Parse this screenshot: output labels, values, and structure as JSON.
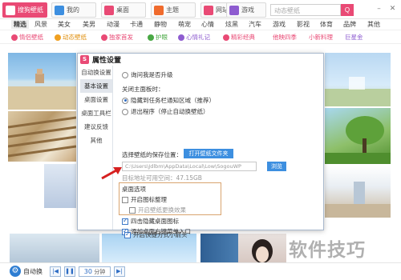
{
  "top_tabs": [
    {
      "label": "搜狗壁纸",
      "color": "#e94a75",
      "active": true
    },
    {
      "label": "我的",
      "color": "#3d8fe0",
      "active": false
    },
    {
      "label": "桌面",
      "color": "#e94a75",
      "active": false
    },
    {
      "label": "主题",
      "color": "#f06b2d",
      "active": false
    },
    {
      "label": "网站",
      "color": "#e94a75",
      "active": false
    },
    {
      "label": "游戏",
      "color": "#8e5cd0",
      "active": false
    }
  ],
  "search": {
    "placeholder": "动态壁纸",
    "button": "Q"
  },
  "window_buttons": {
    "minimize": "–",
    "close": "✕"
  },
  "categories": [
    "精选",
    "风景",
    "美女",
    "美男",
    "动漫",
    "卡通",
    "静物",
    "萌宠",
    "心情",
    "炫黑",
    "汽车",
    "游戏",
    "影视",
    "体育",
    "品牌",
    "其他"
  ],
  "sub_tags": [
    {
      "label": "情侣壁纸",
      "color": "#e94a75"
    },
    {
      "label": "动态壁纸",
      "color": "#f0a020"
    },
    {
      "label": "独家首发",
      "color": "#e94a75"
    },
    {
      "label": "护眼",
      "color": "#49a844"
    },
    {
      "label": "心情礼记",
      "color": "#8e5cd0"
    },
    {
      "label": "精彩经典",
      "color": "#e94a75"
    },
    {
      "label": "他映四季",
      "color": "#e94a75"
    },
    {
      "label": "小新料理",
      "color": "#e94a75"
    },
    {
      "label": "巨星金",
      "color": "#8e5cd0"
    }
  ],
  "dialog": {
    "logo": "S",
    "title": "属性设置",
    "nav": [
      "自动换设置",
      "基本设置",
      "桌面设置",
      "桌面工具栏",
      "建议反馈",
      "其他"
    ],
    "active_nav": 1,
    "upgrade_notice": "询问我是否升级",
    "close_section_title": "关闭主面板时：",
    "close_options": [
      "隐藏到任务栏通知区域（推荐）",
      "退出程序（停止自动换壁纸）"
    ],
    "save_location_title": "选择壁纸的保存位置：",
    "open_folder_button": "打开壁纸文件夹",
    "path_value": "C:\\Users\\Jdlbm\\AppData\\Local\\Low\\SogouWP",
    "browse_button": "浏览",
    "disk_space": "目标地址可用空间：47.15GB",
    "desktop_section_title": "桌面选项",
    "desktop_icon_option": "开启图标整理",
    "desktop_icon_sub_option": "开启壁纸更换效果",
    "other_options": [
      "四击隐藏桌面图标",
      "添加桌面右键菜单入口",
      "开启快捷方式小箭头"
    ]
  },
  "bottom_bar": {
    "auto_switch_label": "自动换",
    "prev": "|◀",
    "pause": "❚❚",
    "interval_value": "30",
    "interval_unit": "分钟",
    "next": "▶|"
  },
  "watermark": "软件技巧"
}
